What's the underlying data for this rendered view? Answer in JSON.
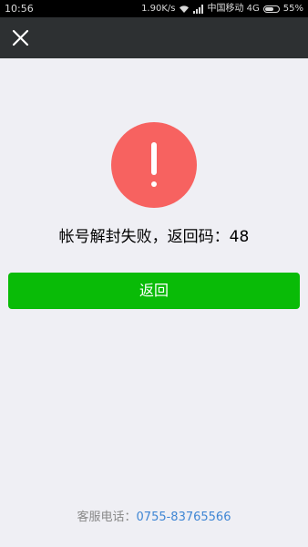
{
  "status_bar": {
    "time": "10:56",
    "speed": "1.90K/s",
    "carrier": "中国移动 4G",
    "battery": "55%",
    "battery_level": 0.55
  },
  "nav": {
    "close_icon": "close-icon"
  },
  "message": {
    "icon": "warning-icon",
    "title": "帐号解封失败，返回码：48"
  },
  "actions": {
    "back_label": "返回"
  },
  "footer": {
    "hotline_label": "客服电话：",
    "hotline_number": "0755-83765566"
  },
  "colors": {
    "accent_green": "#09bb07",
    "warn_red": "#f76260",
    "link_blue": "#3f86d4",
    "nav_bg": "#2d3032",
    "page_bg": "#efeff4"
  }
}
